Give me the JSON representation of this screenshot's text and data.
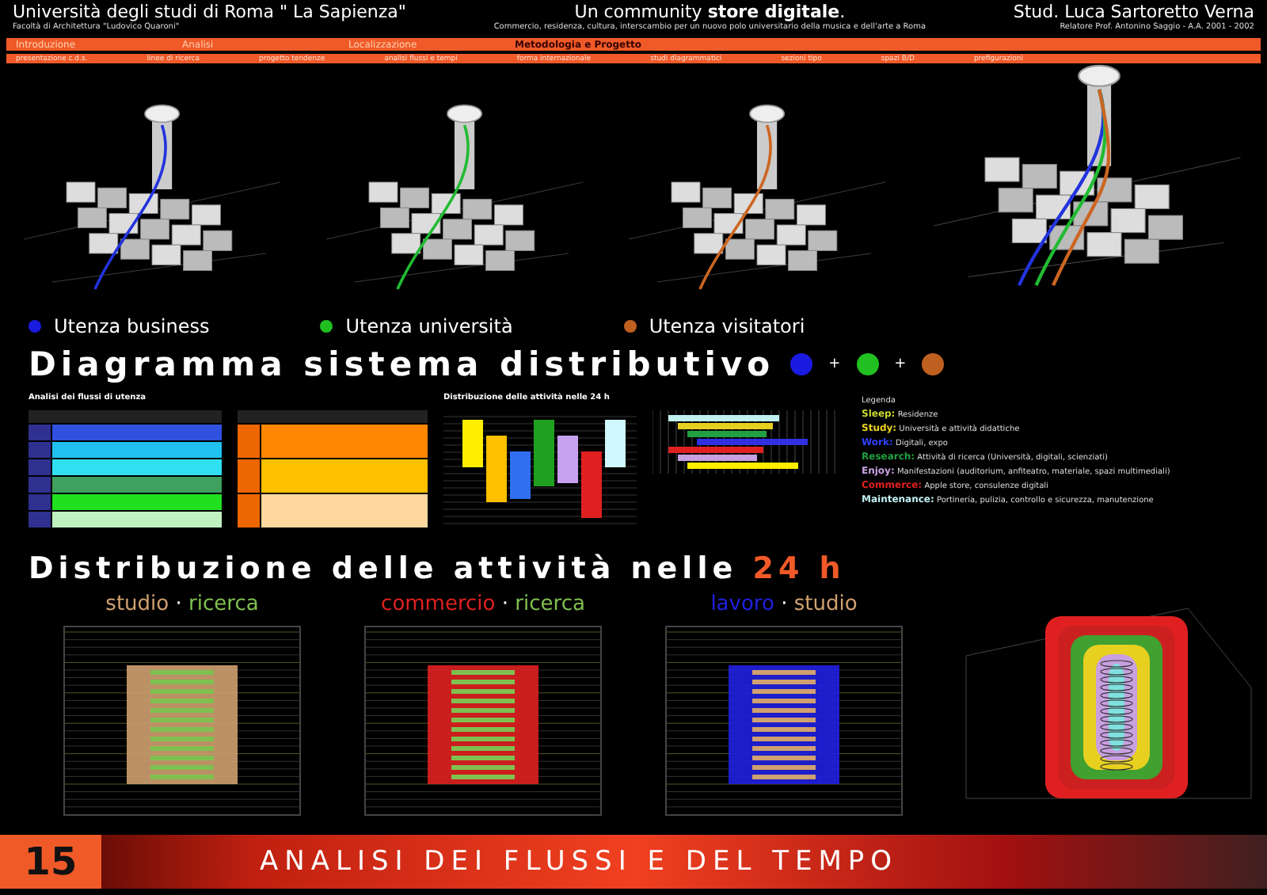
{
  "header": {
    "university": "Università degli studi di Roma \" La Sapienza\"",
    "faculty": "Facoltà di Architettura \"Ludovico Quaroni\"",
    "title": "Un community **store digitale**.",
    "subtitle": "Commercio, residenza, cultura, interscambio per un nuovo polo universitario della musica e dell'arte a Roma",
    "student": "Stud. Luca Sartoretto Verna",
    "supervisor": "Relatore Prof. Antonino Saggio - A.A. 2001 - 2002"
  },
  "nav": [
    {
      "label": "Introduzione",
      "selected": false
    },
    {
      "label": "Analisi",
      "selected": false
    },
    {
      "label": "Localizzazione",
      "selected": false
    },
    {
      "label": "Metodologia e Progetto",
      "selected": true
    }
  ],
  "subnav": [
    {
      "label": "presentazione c.d.s."
    },
    {
      "label": "linee di ricerca"
    },
    {
      "label": "progetto tendenze"
    },
    {
      "label": "analisi flussi e tempi"
    },
    {
      "label": "forma internazionale"
    },
    {
      "label": "studi diagrammatici"
    },
    {
      "label": "sezioni tipo"
    },
    {
      "label": "spazi B/D"
    },
    {
      "label": "prefigurazioni"
    }
  ],
  "maps": [
    {
      "kind": "single",
      "color": "#2233dd"
    },
    {
      "kind": "single",
      "color": "#22bb33"
    },
    {
      "kind": "single",
      "color": "#cc6622"
    },
    {
      "kind": "combined"
    }
  ],
  "user_types": [
    {
      "label": "Utenza business",
      "color": "#1a1ae0"
    },
    {
      "label": "Utenza università",
      "color": "#20c020"
    },
    {
      "label": "Utenza visitatori",
      "color": "#c06020"
    }
  ],
  "section_title_1": "Diagramma sistema distributivo",
  "title_dots": [
    {
      "color": "#1a1ae0"
    },
    {
      "color": "#20c020"
    },
    {
      "color": "#c06020"
    }
  ],
  "dot_separators": [
    "+",
    "+"
  ],
  "tables": [
    {
      "kind": "flow",
      "title": "Analisi dei flussi di utenza"
    },
    {
      "kind": "flow_orange"
    },
    {
      "kind": "schedule",
      "title": "Distribuzione delle attività nelle 24 h"
    },
    {
      "kind": "gantt"
    }
  ],
  "legend": {
    "title": "Legenda",
    "items": [
      {
        "key": "Sleep:",
        "text": "Residenze",
        "color": "#c8d830"
      },
      {
        "key": "Study:",
        "text": "Università e attività didattiche",
        "color": "#e8d020"
      },
      {
        "key": "Work:",
        "text": "Digitali, expo",
        "color": "#3040ff"
      },
      {
        "key": "Research:",
        "text": "Attività di ricerca (Università, digitali, scienziati)",
        "color": "#20a040"
      },
      {
        "key": "Enjoy:",
        "text": "Manifestazioni (auditorium, anfiteatro, materiale, spazi multimediali)",
        "color": "#c8a0e0"
      },
      {
        "key": "Commerce:",
        "text": "Apple store, consulenze digitali",
        "color": "#e02020"
      },
      {
        "key": "Maintenance:",
        "text": "Portineria, pulizia, controllo e sicurezza, manutenzione",
        "color": "#c0f0f0"
      }
    ]
  },
  "section_title_2": {
    "text": "Distribuzione delle attività nelle",
    "highlight": "24 h"
  },
  "charts": [
    {
      "kind": "flat",
      "parts": [
        {
          "text": "studio",
          "color": "#d0a070"
        },
        {
          "text": "ricerca",
          "color": "#80c050"
        }
      ],
      "separator": "·"
    },
    {
      "kind": "flat",
      "parts": [
        {
          "text": "commercio",
          "color": "#e02020"
        },
        {
          "text": "ricerca",
          "color": "#80c050"
        }
      ],
      "separator": "·"
    },
    {
      "kind": "flat",
      "parts": [
        {
          "text": "lavoro",
          "color": "#2020e0"
        },
        {
          "text": "studio",
          "color": "#d0a070"
        }
      ],
      "separator": "·"
    },
    {
      "kind": "tower"
    }
  ],
  "footer": {
    "page": "15",
    "title": "ANALISI DEI FLUSSI E DEL TEMPO"
  }
}
